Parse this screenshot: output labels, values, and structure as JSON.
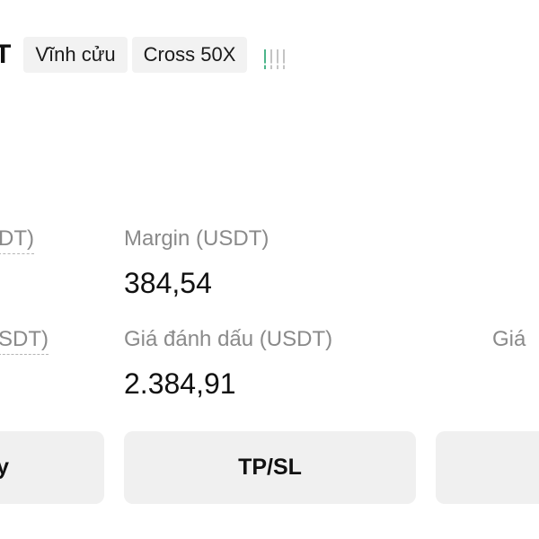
{
  "header": {
    "symbol_tail": "T",
    "tag_contract": "Vĩnh cửu",
    "tag_margin_mode": "Cross 50X",
    "signal": {
      "icon": "signal-strength-icon",
      "active_bars": 1,
      "total_bars": 4,
      "active_color": "#4cb58a",
      "inactive_color": "#c4c4c4"
    }
  },
  "stats": {
    "row1_left_label": "DT)",
    "margin_label": "Margin (USDT)",
    "margin_value": "384,54",
    "row2_left_label": "SDT)",
    "mark_price_label": "Giá đánh dấu (USDT)",
    "mark_price_value": "2.384,91",
    "row2_right_label": "Giá"
  },
  "actions": {
    "left_button_label": "y",
    "tpsl_button_label": "TP/SL",
    "right_button_label": ""
  }
}
